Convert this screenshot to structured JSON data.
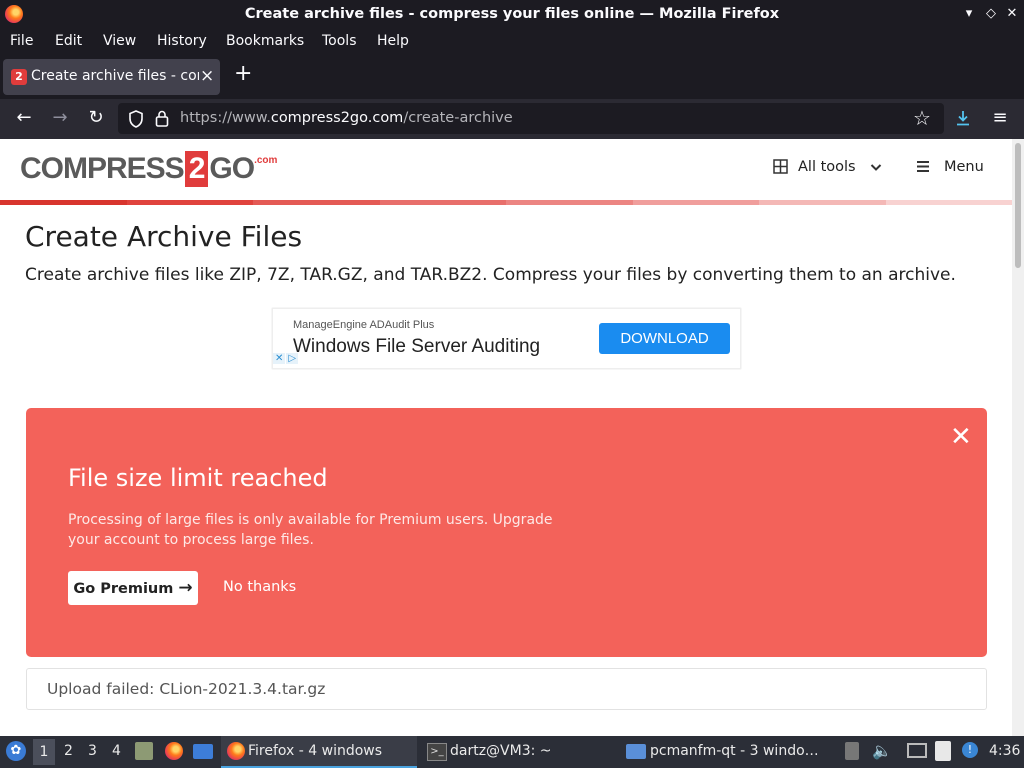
{
  "window": {
    "title": "Create archive files - compress your files online — Mozilla Firefox",
    "controls": [
      "▾",
      "◇",
      "✕"
    ]
  },
  "menubar": {
    "items": [
      {
        "label": "File",
        "key": "F"
      },
      {
        "label": "Edit",
        "key": "E"
      },
      {
        "label": "View",
        "key": "V"
      },
      {
        "label": "History",
        "key": "s"
      },
      {
        "label": "Bookmarks",
        "key": "B"
      },
      {
        "label": "Tools",
        "key": "T"
      },
      {
        "label": "Help",
        "key": "H"
      }
    ]
  },
  "tab": {
    "favicon": "2",
    "title": "Create archive files - compress your files online"
  },
  "navbar": {
    "url_prefix": "https://www.",
    "url_domain": "compress2go.com",
    "url_path": "/create-archive"
  },
  "site": {
    "logo_left": "COMPRESS",
    "logo_num": "2",
    "logo_right": "GO",
    "logo_tld": ".com",
    "all_tools": "All tools",
    "menu": "Menu",
    "colorbar": [
      "#d8352e",
      "#e0433d",
      "#e45a55",
      "#e86f6b",
      "#ec8582",
      "#f09e9c",
      "#f4b8b6",
      "#f8d2d1"
    ]
  },
  "main": {
    "heading": "Create Archive Files",
    "subheading": "Create archive files like ZIP, 7Z, TAR.GZ, and TAR.BZ2. Compress your files by converting them to an archive."
  },
  "ad": {
    "sponsor": "ManageEngine ADAudit Plus",
    "headline": "Windows File Server Auditing",
    "cta": "DOWNLOAD"
  },
  "alert": {
    "title": "File size limit reached",
    "message": "Processing of large files is only available for Premium users. Upgrade your account to process large files.",
    "primary_button": "Go Premium",
    "secondary_button": "No thanks",
    "bg_color": "#f3625a"
  },
  "upload_status": "Upload failed: CLion-2021.3.4.tar.gz",
  "taskbar": {
    "workspaces": [
      "1",
      "2",
      "3",
      "4"
    ],
    "tasks": [
      {
        "label": "Firefox - 4 windows"
      },
      {
        "label": "dartz@VM3: ~"
      },
      {
        "label": "pcmanfm-qt - 3 windo…"
      }
    ],
    "clock": "4:36"
  }
}
